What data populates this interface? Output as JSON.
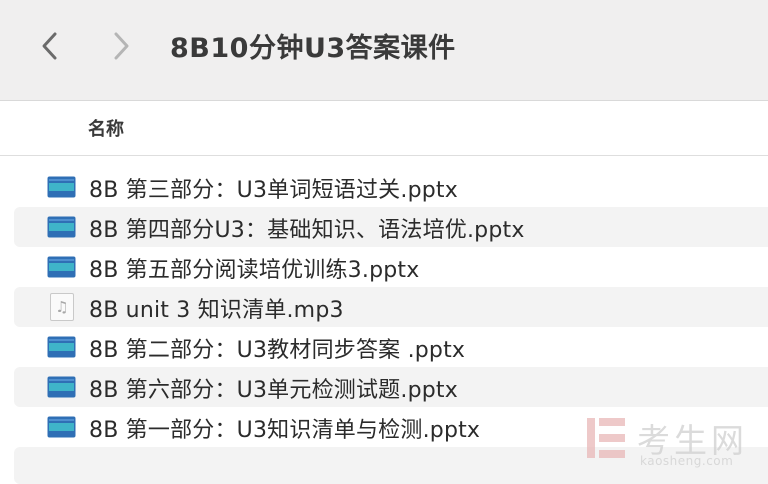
{
  "window": {
    "title": "8B10分钟U3答案课件"
  },
  "toolbar": {
    "back_icon": "chevron-left-icon",
    "forward_icon": "chevron-right-icon"
  },
  "list_header": {
    "name_column": "名称"
  },
  "files": [
    {
      "name": "8B 第三部分：U3单词短语过关.pptx",
      "type": "pptx"
    },
    {
      "name": "8B 第四部分U3：基础知识、语法培优.pptx",
      "type": "pptx"
    },
    {
      "name": "8B 第五部分阅读培优训练3.pptx",
      "type": "pptx"
    },
    {
      "name": "8B unit 3 知识清单.mp3",
      "type": "mp3"
    },
    {
      "name": "8B 第二部分：U3教材同步答案 .pptx",
      "type": "pptx"
    },
    {
      "name": "8B 第六部分：U3单元检测试题.pptx",
      "type": "pptx"
    },
    {
      "name": "8B 第一部分：U3知识清单与检测.pptx",
      "type": "pptx"
    }
  ],
  "watermark": {
    "text": "考生网",
    "url": "kaosheng.com"
  },
  "colors": {
    "toolbar_bg": "#f0efef",
    "alt_row_bg": "#f3f3f3",
    "pptx_icon_blue": "#2f6fb5",
    "pptx_icon_teal": "#3fb4c9"
  }
}
